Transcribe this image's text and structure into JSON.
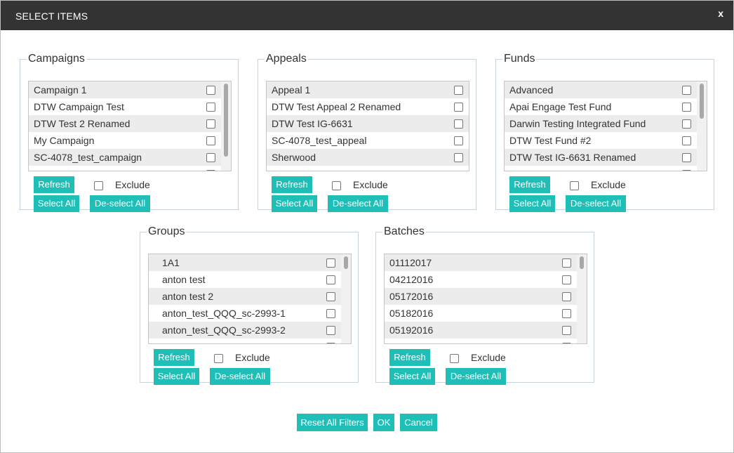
{
  "dialog": {
    "title": "SELECT ITEMS",
    "close_label": "x"
  },
  "panels": [
    {
      "legend": "Campaigns",
      "items": [
        "Campaign 1",
        "DTW Campaign Test",
        "DTW Test 2 Renamed",
        "My Campaign",
        "SC-4078_test_campaign"
      ]
    },
    {
      "legend": "Appeals",
      "items": [
        "Appeal 1",
        "DTW Test Appeal 2 Renamed",
        "DTW Test IG-6631",
        "SC-4078_test_appeal",
        "Sherwood"
      ]
    },
    {
      "legend": "Funds",
      "items": [
        "Advanced",
        "Apai Engage Test Fund",
        "Darwin Testing Integrated Fund",
        "DTW Test Fund #2",
        "DTW Test IG-6631 Renamed"
      ]
    },
    {
      "legend": "Groups",
      "items": [
        "1A1",
        "anton test",
        "anton test 2",
        "anton_test_QQQ_sc-2993-1",
        "anton_test_QQQ_sc-2993-2"
      ]
    },
    {
      "legend": "Batches",
      "items": [
        "01112017",
        "04212016",
        "05172016",
        "05182016",
        "05192016"
      ]
    }
  ],
  "panel_controls": {
    "refresh_label": "Refresh",
    "exclude_label": "Exclude",
    "select_all_label": "Select All",
    "deselect_all_label": "De-select All"
  },
  "footer": {
    "reset_label": "Reset All Filters",
    "ok_label": "OK",
    "cancel_label": "Cancel"
  },
  "colors": {
    "accent": "#1fbfb8",
    "titlebar": "#333333"
  }
}
